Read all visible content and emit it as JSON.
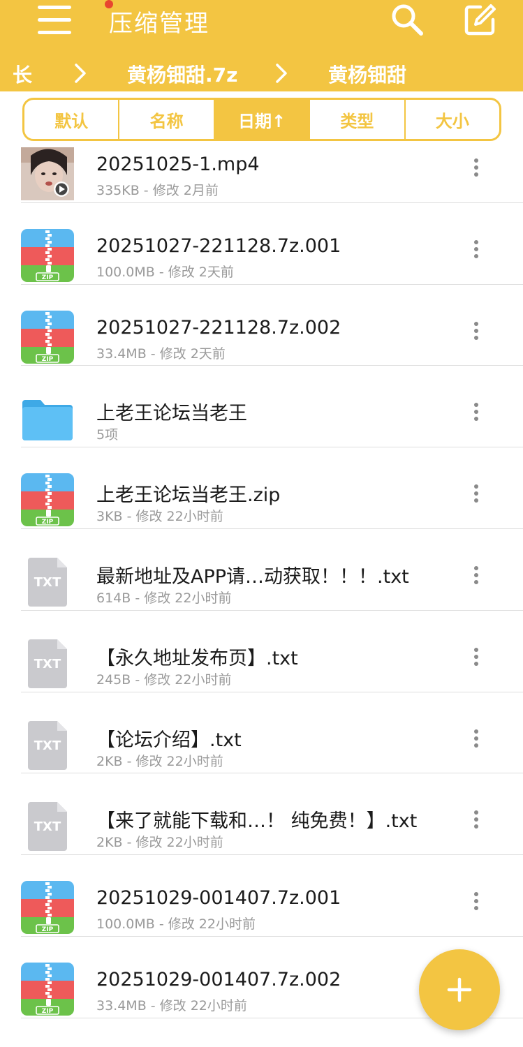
{
  "appbar": {
    "title": "压缩管理",
    "menu_icon": "hamburger-menu-icon",
    "search_icon": "search-icon",
    "edit_icon": "edit-icon",
    "background": "#F3C542",
    "menu_badge_color": "#e8452f"
  },
  "breadcrumb": {
    "items": [
      "长",
      "黄杨钿甜.7z",
      "黄杨钿甜"
    ],
    "separator_icon": "chevron-right-icon"
  },
  "sort_tabs": [
    "默认",
    "名称",
    "日期↑",
    "类型",
    "大小"
  ],
  "sort_active": "日期↑",
  "files": [
    {
      "name": "20251025-1.mp4",
      "meta": "335KB - 修改 2月前",
      "type": "video",
      "icon": "video-thumbnail-icon"
    },
    {
      "name": "20251027-221128.7z.001",
      "meta": "100.0MB - 修改 2天前",
      "type": "zip",
      "icon": "zip-archive-icon"
    },
    {
      "name": "20251027-221128.7z.002",
      "meta": "33.4MB - 修改 2天前",
      "type": "zip",
      "icon": "zip-archive-icon"
    },
    {
      "name": "上老王论坛当老王",
      "meta": "5项",
      "type": "folder",
      "icon": "folder-icon"
    },
    {
      "name": "上老王论坛当老王.zip",
      "meta": "3KB - 修改 22小时前",
      "type": "zip",
      "icon": "zip-archive-icon"
    },
    {
      "name": "最新地址及APP请…动获取！！！.txt",
      "meta": "614B - 修改 22小时前",
      "type": "txt",
      "icon": "txt-file-icon"
    },
    {
      "name": "【永久地址发布页】.txt",
      "meta": "245B - 修改 22小时前",
      "type": "txt",
      "icon": "txt-file-icon"
    },
    {
      "name": "【论坛介绍】.txt",
      "meta": "2KB - 修改 22小时前",
      "type": "txt",
      "icon": "txt-file-icon"
    },
    {
      "name": "【来了就能下载和…！ 纯免费！】.txt",
      "meta": "2KB - 修改 22小时前",
      "type": "txt",
      "icon": "txt-file-icon"
    },
    {
      "name": "20251029-001407.7z.001",
      "meta": "100.0MB - 修改 22小时前",
      "type": "zip",
      "icon": "zip-archive-icon"
    },
    {
      "name": "20251029-001407.7z.002",
      "meta": "33.4MB - 修改 22小时前",
      "type": "zip",
      "icon": "zip-archive-icon"
    }
  ],
  "icon_labels": {
    "zip": "ZIP",
    "txt": "TXT"
  },
  "fab": {
    "icon": "plus-icon"
  },
  "colors": {
    "accent": "#F3C542",
    "zip_blue": "#5BB8F0",
    "zip_red": "#EE5A5A",
    "zip_green": "#6CC24A",
    "folder_blue": "#5EC0F5",
    "txt_gray": "#CACACE"
  }
}
